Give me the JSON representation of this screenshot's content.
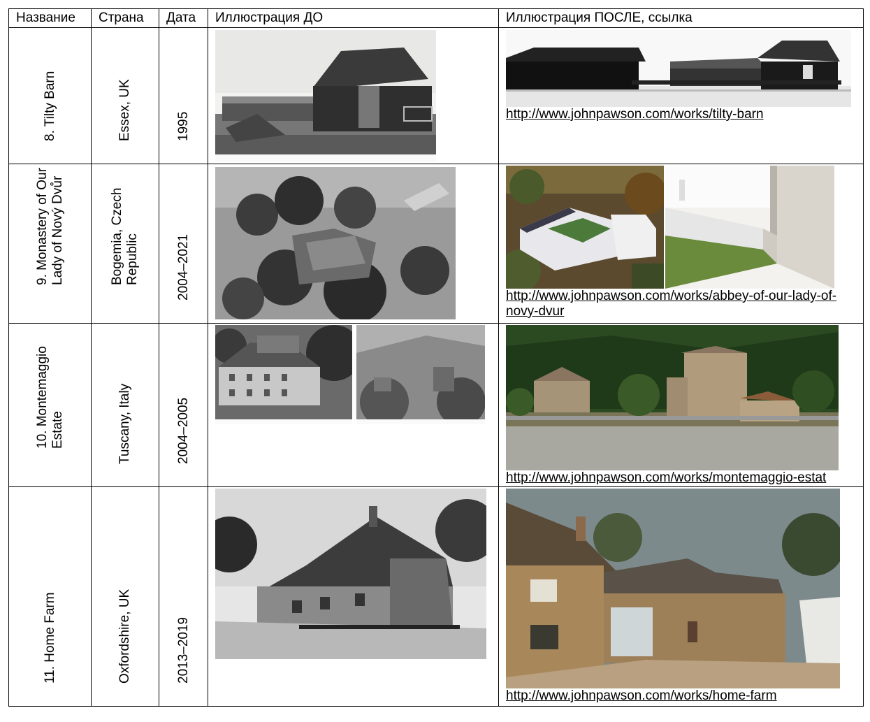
{
  "header": {
    "col_name": "Название",
    "col_country": "Страна",
    "col_date": "Дата",
    "col_before": "Иллюстрация ДО",
    "col_after": "Иллюстрация ПОСЛЕ, ссылка"
  },
  "rows": [
    {
      "name": "8. Tilty Barn",
      "country": "Essex, UK",
      "date": "1995",
      "link": "http://www.johnpawson.com/works/tilty-barn"
    },
    {
      "name_line1": "9. Monastery of Our",
      "name_line2": "Lady of Nový Dvůr",
      "country_line1": "Bogemia, Czech",
      "country_line2": "Republic",
      "date": "2004–2021",
      "link": "http://www.johnpawson.com/works/abbey-of-our-lady-of-novy-dvur"
    },
    {
      "name_line1": "10. Montemaggio",
      "name_line2": "Estate",
      "country": "Tuscany, Italy",
      "date": "2004–2005",
      "link": "http://www.johnpawson.com/works/montemaggio-estat"
    },
    {
      "name": "11. Home Farm",
      "country": "Oxfordshire, UK",
      "date": "2013–2019",
      "link": "http://www.johnpawson.com/works/home-farm"
    }
  ]
}
